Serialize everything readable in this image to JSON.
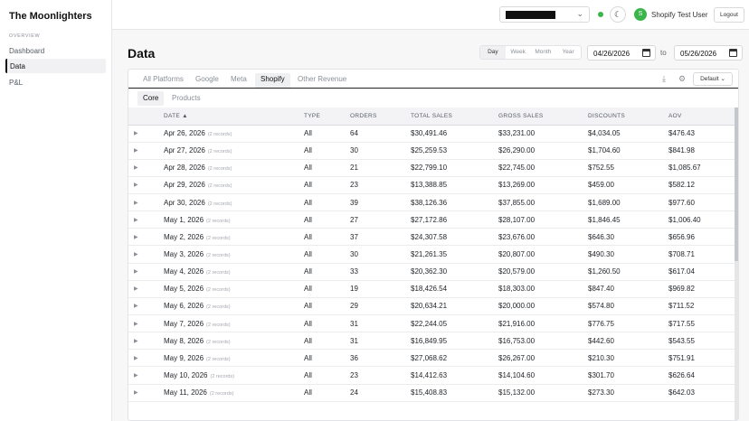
{
  "app": {
    "brand": "The Moonlighters"
  },
  "sidebar": {
    "section": "OVERVIEW",
    "items": [
      {
        "label": "Dashboard",
        "active": false
      },
      {
        "label": "Data",
        "active": true
      },
      {
        "label": "P&L",
        "active": false
      }
    ]
  },
  "header": {
    "store_select": {
      "value": "",
      "redacted": true
    },
    "theme_icon": "moon-icon",
    "avatar_letter": "S",
    "user_name": "Shopify Test User",
    "logout_label": "Logout",
    "status_color": "#3bb54a"
  },
  "page": {
    "title": "Data",
    "ranges": [
      "Day",
      "Week",
      "Month",
      "Year"
    ],
    "active_range": "Day",
    "date_from": "04/26/2026",
    "to_label": "to",
    "date_to": "05/26/2026"
  },
  "tabs": {
    "platforms": [
      "All Platforms",
      "Google",
      "Meta",
      "Shopify",
      "Other Revenue"
    ],
    "active": "Shopify",
    "default_label": "Default",
    "subtabs": [
      "Core",
      "Products"
    ],
    "active_subtab": "Core"
  },
  "table": {
    "columns": [
      "",
      "DATE ▲",
      "TYPE",
      "ORDERS",
      "TOTAL SALES",
      "GROSS SALES",
      "DISCOUNTS",
      "AOV"
    ],
    "rows": [
      {
        "date": "Apr 26, 2026",
        "records": "(2 records)",
        "type": "All",
        "orders": "64",
        "total_sales": "$30,491.46",
        "gross_sales": "$33,231.00",
        "discounts": "$4,034.05",
        "aov": "$476.43"
      },
      {
        "date": "Apr 27, 2026",
        "records": "(2 records)",
        "type": "All",
        "orders": "30",
        "total_sales": "$25,259.53",
        "gross_sales": "$26,290.00",
        "discounts": "$1,704.60",
        "aov": "$841.98"
      },
      {
        "date": "Apr 28, 2026",
        "records": "(2 records)",
        "type": "All",
        "orders": "21",
        "total_sales": "$22,799.10",
        "gross_sales": "$22,745.00",
        "discounts": "$752.55",
        "aov": "$1,085.67"
      },
      {
        "date": "Apr 29, 2026",
        "records": "(2 records)",
        "type": "All",
        "orders": "23",
        "total_sales": "$13,388.85",
        "gross_sales": "$13,269.00",
        "discounts": "$459.00",
        "aov": "$582.12"
      },
      {
        "date": "Apr 30, 2026",
        "records": "(2 records)",
        "type": "All",
        "orders": "39",
        "total_sales": "$38,126.36",
        "gross_sales": "$37,855.00",
        "discounts": "$1,689.00",
        "aov": "$977.60"
      },
      {
        "date": "May 1, 2026",
        "records": "(2 records)",
        "type": "All",
        "orders": "27",
        "total_sales": "$27,172.86",
        "gross_sales": "$28,107.00",
        "discounts": "$1,846.45",
        "aov": "$1,006.40"
      },
      {
        "date": "May 2, 2026",
        "records": "(2 records)",
        "type": "All",
        "orders": "37",
        "total_sales": "$24,307.58",
        "gross_sales": "$23,676.00",
        "discounts": "$646.30",
        "aov": "$656.96"
      },
      {
        "date": "May 3, 2026",
        "records": "(2 records)",
        "type": "All",
        "orders": "30",
        "total_sales": "$21,261.35",
        "gross_sales": "$20,807.00",
        "discounts": "$490.30",
        "aov": "$708.71"
      },
      {
        "date": "May 4, 2026",
        "records": "(2 records)",
        "type": "All",
        "orders": "33",
        "total_sales": "$20,362.30",
        "gross_sales": "$20,579.00",
        "discounts": "$1,260.50",
        "aov": "$617.04"
      },
      {
        "date": "May 5, 2026",
        "records": "(2 records)",
        "type": "All",
        "orders": "19",
        "total_sales": "$18,426.54",
        "gross_sales": "$18,303.00",
        "discounts": "$847.40",
        "aov": "$969.82"
      },
      {
        "date": "May 6, 2026",
        "records": "(2 records)",
        "type": "All",
        "orders": "29",
        "total_sales": "$20,634.21",
        "gross_sales": "$20,000.00",
        "discounts": "$574.80",
        "aov": "$711.52"
      },
      {
        "date": "May 7, 2026",
        "records": "(2 records)",
        "type": "All",
        "orders": "31",
        "total_sales": "$22,244.05",
        "gross_sales": "$21,916.00",
        "discounts": "$776.75",
        "aov": "$717.55"
      },
      {
        "date": "May 8, 2026",
        "records": "(2 records)",
        "type": "All",
        "orders": "31",
        "total_sales": "$16,849.95",
        "gross_sales": "$16,753.00",
        "discounts": "$442.60",
        "aov": "$543.55"
      },
      {
        "date": "May 9, 2026",
        "records": "(2 records)",
        "type": "All",
        "orders": "36",
        "total_sales": "$27,068.62",
        "gross_sales": "$26,267.00",
        "discounts": "$210.30",
        "aov": "$751.91"
      },
      {
        "date": "May 10, 2026",
        "records": "(2 records)",
        "type": "All",
        "orders": "23",
        "total_sales": "$14,412.63",
        "gross_sales": "$14,104.60",
        "discounts": "$301.70",
        "aov": "$626.64"
      },
      {
        "date": "May 11, 2026",
        "records": "(2 records)",
        "type": "All",
        "orders": "24",
        "total_sales": "$15,408.83",
        "gross_sales": "$15,132.00",
        "discounts": "$273.30",
        "aov": "$642.03"
      }
    ]
  }
}
